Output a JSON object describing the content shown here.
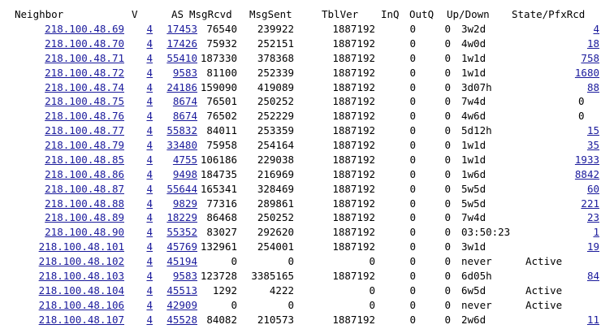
{
  "header": {
    "neighbor": "Neighbor",
    "v": "V",
    "as": "AS",
    "msg_rcvd": "MsgRcvd",
    "msg_sent": "MsgSent",
    "tbl_ver": "TblVer",
    "inq": "InQ",
    "outq": "OutQ",
    "up_down": "Up/Down",
    "state_pfx": "State/PfxRcd"
  },
  "rows": [
    {
      "neighbor": "218.100.48.69",
      "v": "4",
      "as": "17453",
      "msg_rcvd": "76540",
      "msg_sent": "239922",
      "tbl_ver": "1887192",
      "inq": "0",
      "outq": "0",
      "up_down": "3w2d",
      "state_pfx": "4",
      "state_link": true
    },
    {
      "neighbor": "218.100.48.70",
      "v": "4",
      "as": "17426",
      "msg_rcvd": "75932",
      "msg_sent": "252151",
      "tbl_ver": "1887192",
      "inq": "0",
      "outq": "0",
      "up_down": "4w0d",
      "state_pfx": "18",
      "state_link": true
    },
    {
      "neighbor": "218.100.48.71",
      "v": "4",
      "as": "55410",
      "msg_rcvd": "187330",
      "msg_sent": "378368",
      "tbl_ver": "1887192",
      "inq": "0",
      "outq": "0",
      "up_down": "1w1d",
      "state_pfx": "758",
      "state_link": true
    },
    {
      "neighbor": "218.100.48.72",
      "v": "4",
      "as": "9583",
      "msg_rcvd": "81100",
      "msg_sent": "252339",
      "tbl_ver": "1887192",
      "inq": "0",
      "outq": "0",
      "up_down": "1w1d",
      "state_pfx": "1680",
      "state_link": true
    },
    {
      "neighbor": "218.100.48.74",
      "v": "4",
      "as": "24186",
      "msg_rcvd": "159090",
      "msg_sent": "419089",
      "tbl_ver": "1887192",
      "inq": "0",
      "outq": "0",
      "up_down": "3d07h",
      "state_pfx": "88",
      "state_link": true
    },
    {
      "neighbor": "218.100.48.75",
      "v": "4",
      "as": "8674",
      "msg_rcvd": "76501",
      "msg_sent": "250252",
      "tbl_ver": "1887192",
      "inq": "0",
      "outq": "0",
      "up_down": "7w4d",
      "state_pfx": "0",
      "state_link": false
    },
    {
      "neighbor": "218.100.48.76",
      "v": "4",
      "as": "8674",
      "msg_rcvd": "76502",
      "msg_sent": "252229",
      "tbl_ver": "1887192",
      "inq": "0",
      "outq": "0",
      "up_down": "4w6d",
      "state_pfx": "0",
      "state_link": false
    },
    {
      "neighbor": "218.100.48.77",
      "v": "4",
      "as": "55832",
      "msg_rcvd": "84011",
      "msg_sent": "253359",
      "tbl_ver": "1887192",
      "inq": "0",
      "outq": "0",
      "up_down": "5d12h",
      "state_pfx": "15",
      "state_link": true
    },
    {
      "neighbor": "218.100.48.79",
      "v": "4",
      "as": "33480",
      "msg_rcvd": "75958",
      "msg_sent": "254164",
      "tbl_ver": "1887192",
      "inq": "0",
      "outq": "0",
      "up_down": "1w1d",
      "state_pfx": "35",
      "state_link": true
    },
    {
      "neighbor": "218.100.48.85",
      "v": "4",
      "as": "4755",
      "msg_rcvd": "106186",
      "msg_sent": "229038",
      "tbl_ver": "1887192",
      "inq": "0",
      "outq": "0",
      "up_down": "1w1d",
      "state_pfx": "1933",
      "state_link": true
    },
    {
      "neighbor": "218.100.48.86",
      "v": "4",
      "as": "9498",
      "msg_rcvd": "184735",
      "msg_sent": "216969",
      "tbl_ver": "1887192",
      "inq": "0",
      "outq": "0",
      "up_down": "1w6d",
      "state_pfx": "8842",
      "state_link": true
    },
    {
      "neighbor": "218.100.48.87",
      "v": "4",
      "as": "55644",
      "msg_rcvd": "165341",
      "msg_sent": "328469",
      "tbl_ver": "1887192",
      "inq": "0",
      "outq": "0",
      "up_down": "5w5d",
      "state_pfx": "60",
      "state_link": true
    },
    {
      "neighbor": "218.100.48.88",
      "v": "4",
      "as": "9829",
      "msg_rcvd": "77316",
      "msg_sent": "289861",
      "tbl_ver": "1887192",
      "inq": "0",
      "outq": "0",
      "up_down": "5w5d",
      "state_pfx": "221",
      "state_link": true
    },
    {
      "neighbor": "218.100.48.89",
      "v": "4",
      "as": "18229",
      "msg_rcvd": "86468",
      "msg_sent": "250252",
      "tbl_ver": "1887192",
      "inq": "0",
      "outq": "0",
      "up_down": "7w4d",
      "state_pfx": "23",
      "state_link": true
    },
    {
      "neighbor": "218.100.48.90",
      "v": "4",
      "as": "55352",
      "msg_rcvd": "83027",
      "msg_sent": "292620",
      "tbl_ver": "1887192",
      "inq": "0",
      "outq": "0",
      "up_down": "03:50:23",
      "state_pfx": "1",
      "state_link": true
    },
    {
      "neighbor": "218.100.48.101",
      "v": "4",
      "as": "45769",
      "msg_rcvd": "132961",
      "msg_sent": "254001",
      "tbl_ver": "1887192",
      "inq": "0",
      "outq": "0",
      "up_down": "3w1d",
      "state_pfx": "19",
      "state_link": true
    },
    {
      "neighbor": "218.100.48.102",
      "v": "4",
      "as": "45194",
      "msg_rcvd": "0",
      "msg_sent": "0",
      "tbl_ver": "0",
      "inq": "0",
      "outq": "0",
      "up_down": "never",
      "state_pfx": "Active",
      "state_link": false
    },
    {
      "neighbor": "218.100.48.103",
      "v": "4",
      "as": "9583",
      "msg_rcvd": "123728",
      "msg_sent": "3385165",
      "tbl_ver": "1887192",
      "inq": "0",
      "outq": "0",
      "up_down": "6d05h",
      "state_pfx": "84",
      "state_link": true
    },
    {
      "neighbor": "218.100.48.104",
      "v": "4",
      "as": "45513",
      "msg_rcvd": "1292",
      "msg_sent": "4222",
      "tbl_ver": "0",
      "inq": "0",
      "outq": "0",
      "up_down": "6w5d",
      "state_pfx": "Active",
      "state_link": false
    },
    {
      "neighbor": "218.100.48.106",
      "v": "4",
      "as": "42909",
      "msg_rcvd": "0",
      "msg_sent": "0",
      "tbl_ver": "0",
      "inq": "0",
      "outq": "0",
      "up_down": "never",
      "state_pfx": "Active",
      "state_link": false
    },
    {
      "neighbor": "218.100.48.107",
      "v": "4",
      "as": "45528",
      "msg_rcvd": "84082",
      "msg_sent": "210573",
      "tbl_ver": "1887192",
      "inq": "0",
      "outq": "0",
      "up_down": "2w6d",
      "state_pfx": "11",
      "state_link": true
    }
  ],
  "colors": {
    "link": "#1a1a9c",
    "text": "#000000",
    "background": "#ffffff"
  }
}
